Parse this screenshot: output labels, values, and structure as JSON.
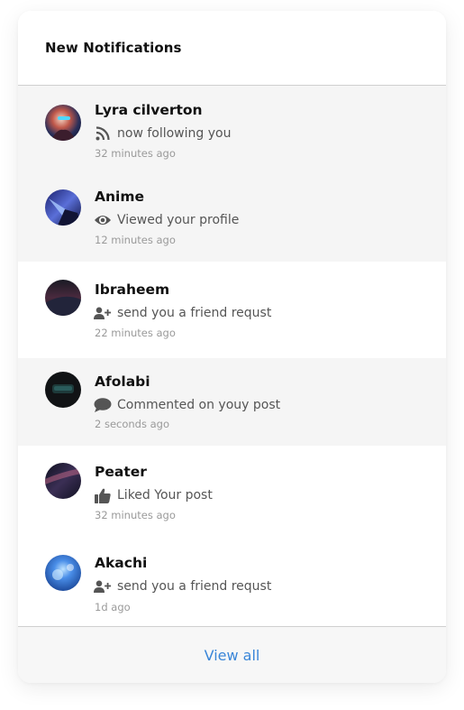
{
  "header": {
    "title": "New Notifications"
  },
  "notifications": [
    {
      "name": "Lyra cilverton",
      "action": "now following you",
      "time": "32 minutes ago",
      "icon": "rss-icon",
      "unread": true
    },
    {
      "name": "Anime",
      "action": "Viewed your profile",
      "time": "12 minutes ago",
      "icon": "eye-icon",
      "unread": true
    },
    {
      "name": "Ibraheem",
      "action": "send you a friend requst",
      "time": "22 minutes ago",
      "icon": "user-plus-icon",
      "unread": false
    },
    {
      "name": "Afolabi",
      "action": "Commented on youy post",
      "time": "2 seconds ago",
      "icon": "comment-icon",
      "unread": true
    },
    {
      "name": "Peater",
      "action": "Liked Your post",
      "time": "32 minutes ago",
      "icon": "thumbs-up-icon",
      "unread": false
    },
    {
      "name": "Akachi",
      "action": "send you a friend requst",
      "time": "1d ago",
      "icon": "user-plus-icon",
      "unread": false
    }
  ],
  "footer": {
    "view_all": "View all"
  },
  "colors": {
    "link": "#3a86d8",
    "unread_bg": "#f5f5f5",
    "icon": "#555555"
  }
}
